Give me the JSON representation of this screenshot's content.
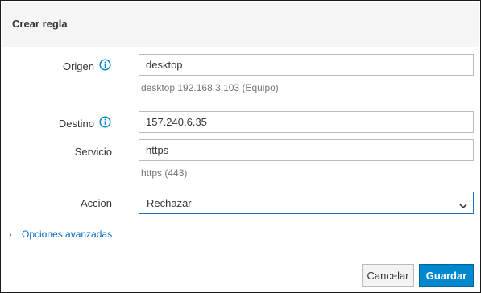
{
  "dialog": {
    "title": "Crear regla"
  },
  "form": {
    "origin": {
      "label": "Origen",
      "value": "desktop",
      "help": "desktop 192.168.3.103 (Equipo)"
    },
    "destination": {
      "label": "Destino",
      "value": "157.240.6.35"
    },
    "service": {
      "label": "Servicio",
      "value": "https",
      "help": "https (443)"
    },
    "action": {
      "label": "Accion",
      "selected": "Rechazar"
    }
  },
  "advanced": {
    "label": "Opciones avanzadas"
  },
  "buttons": {
    "cancel": "Cancelar",
    "save": "Guardar"
  },
  "colors": {
    "accent": "#0088ce",
    "link": "#0066cc",
    "info_icon": "#0088ce",
    "focus_border": "#1e6fb7"
  },
  "icons": {
    "origin_info": "info-circle-icon",
    "destination_info": "info-circle-icon",
    "select_arrow": "chevron-down-icon",
    "advanced_toggle": "chevron-right-icon"
  }
}
